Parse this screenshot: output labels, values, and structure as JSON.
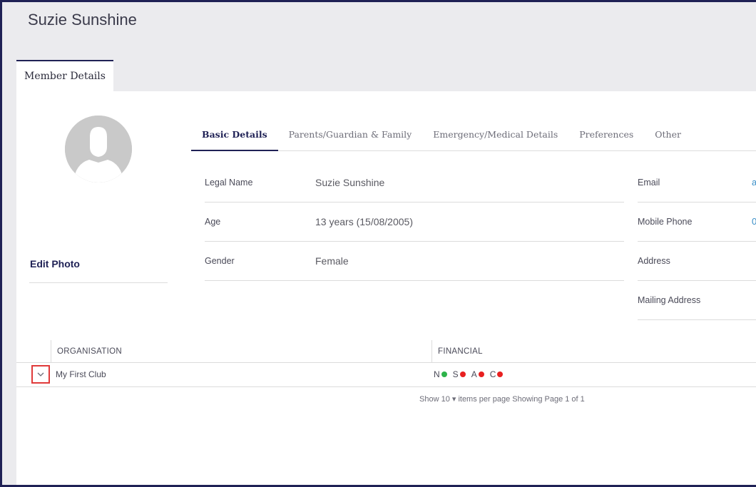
{
  "header": {
    "title": "Suzie Sunshine"
  },
  "top_tabs": [
    {
      "label": "Member Details"
    }
  ],
  "photo": {
    "edit_label": "Edit Photo"
  },
  "sub_tabs": [
    {
      "label": "Basic Details",
      "active": true
    },
    {
      "label": "Parents/Guardian & Family"
    },
    {
      "label": "Emergency/Medical Details"
    },
    {
      "label": "Preferences"
    },
    {
      "label": "Other"
    }
  ],
  "basic_details": [
    {
      "label": "Legal Name",
      "value": "Suzie Sunshine"
    },
    {
      "label": "Age",
      "value": "13 years (15/08/2005)"
    },
    {
      "label": "Gender",
      "value": "Female"
    }
  ],
  "contact_details": [
    {
      "label": "Email",
      "value": "a"
    },
    {
      "label": "Mobile Phone",
      "value": "0"
    },
    {
      "label": "Address",
      "value": ""
    },
    {
      "label": "Mailing Address",
      "value": ""
    }
  ],
  "table": {
    "headers": {
      "organisation": "ORGANISATION",
      "financial": "FINANCIAL"
    },
    "rows": [
      {
        "expand_icon": "chevron-down-icon",
        "organisation": "My First Club",
        "financial": [
          {
            "letter": "N",
            "color": "#2db34a"
          },
          {
            "letter": "S",
            "color": "#e82020"
          },
          {
            "letter": "A",
            "color": "#e82020"
          },
          {
            "letter": "C",
            "color": "#e82020"
          }
        ]
      }
    ]
  },
  "footer": {
    "text": "Show 10 ▾ items per page    Showing Page 1 of 1"
  },
  "colors": {
    "accent": "#1f2155",
    "link": "#3a8fc8",
    "ok": "#2db34a",
    "bad": "#e82020"
  }
}
